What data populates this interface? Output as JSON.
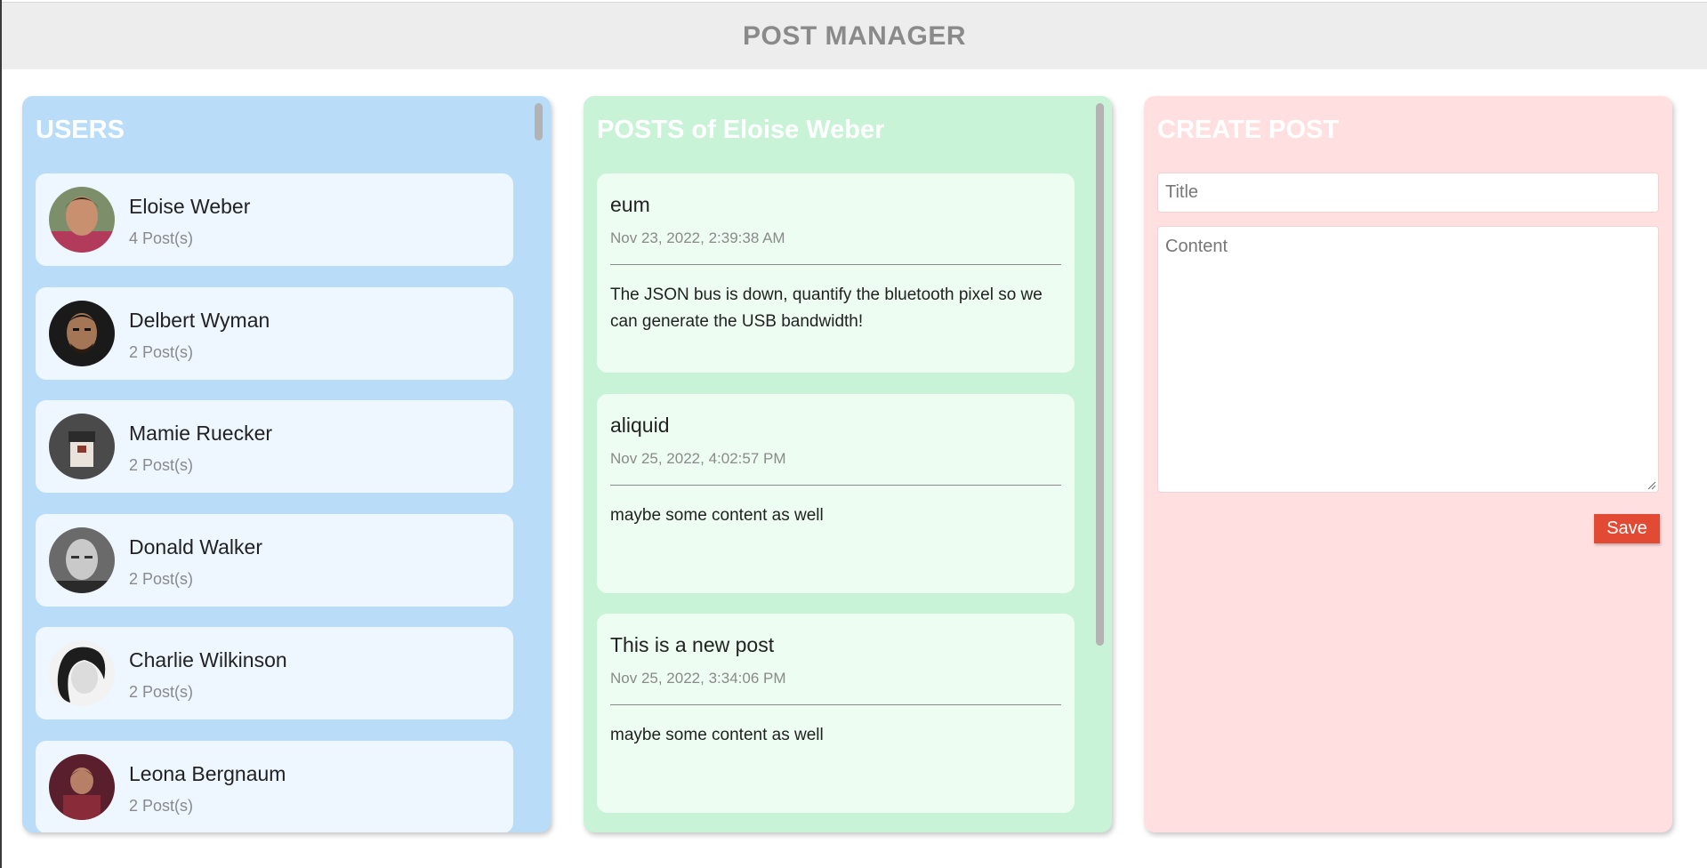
{
  "app": {
    "title": "POST MANAGER"
  },
  "users_panel": {
    "title": "USERS",
    "users": [
      {
        "name": "Eloise Weber",
        "posts": "4 Post(s)"
      },
      {
        "name": "Delbert Wyman",
        "posts": "2 Post(s)"
      },
      {
        "name": "Mamie Ruecker",
        "posts": "2 Post(s)"
      },
      {
        "name": "Donald Walker",
        "posts": "2 Post(s)"
      },
      {
        "name": "Charlie Wilkinson",
        "posts": "2 Post(s)"
      },
      {
        "name": "Leona Bergnaum",
        "posts": "2 Post(s)"
      }
    ]
  },
  "posts_panel": {
    "title": "POSTS of Eloise Weber",
    "posts": [
      {
        "title": "eum",
        "date": "Nov 23, 2022, 2:39:38 AM",
        "body": "The JSON bus is down, quantify the bluetooth pixel so we can generate the USB bandwidth!"
      },
      {
        "title": "aliquid",
        "date": "Nov 25, 2022, 4:02:57 PM",
        "body": "maybe some content as well"
      },
      {
        "title": "This is a new post",
        "date": "Nov 25, 2022, 3:34:06 PM",
        "body": "maybe some content as well"
      }
    ]
  },
  "create_panel": {
    "title": "CREATE POST",
    "title_placeholder": "Title",
    "content_placeholder": "Content",
    "save_label": "Save"
  },
  "colors": {
    "users_panel": "#b9ddf8",
    "posts_panel": "#c9f3d6",
    "create_panel": "#ffdfe0",
    "save_button": "#e34a34"
  }
}
